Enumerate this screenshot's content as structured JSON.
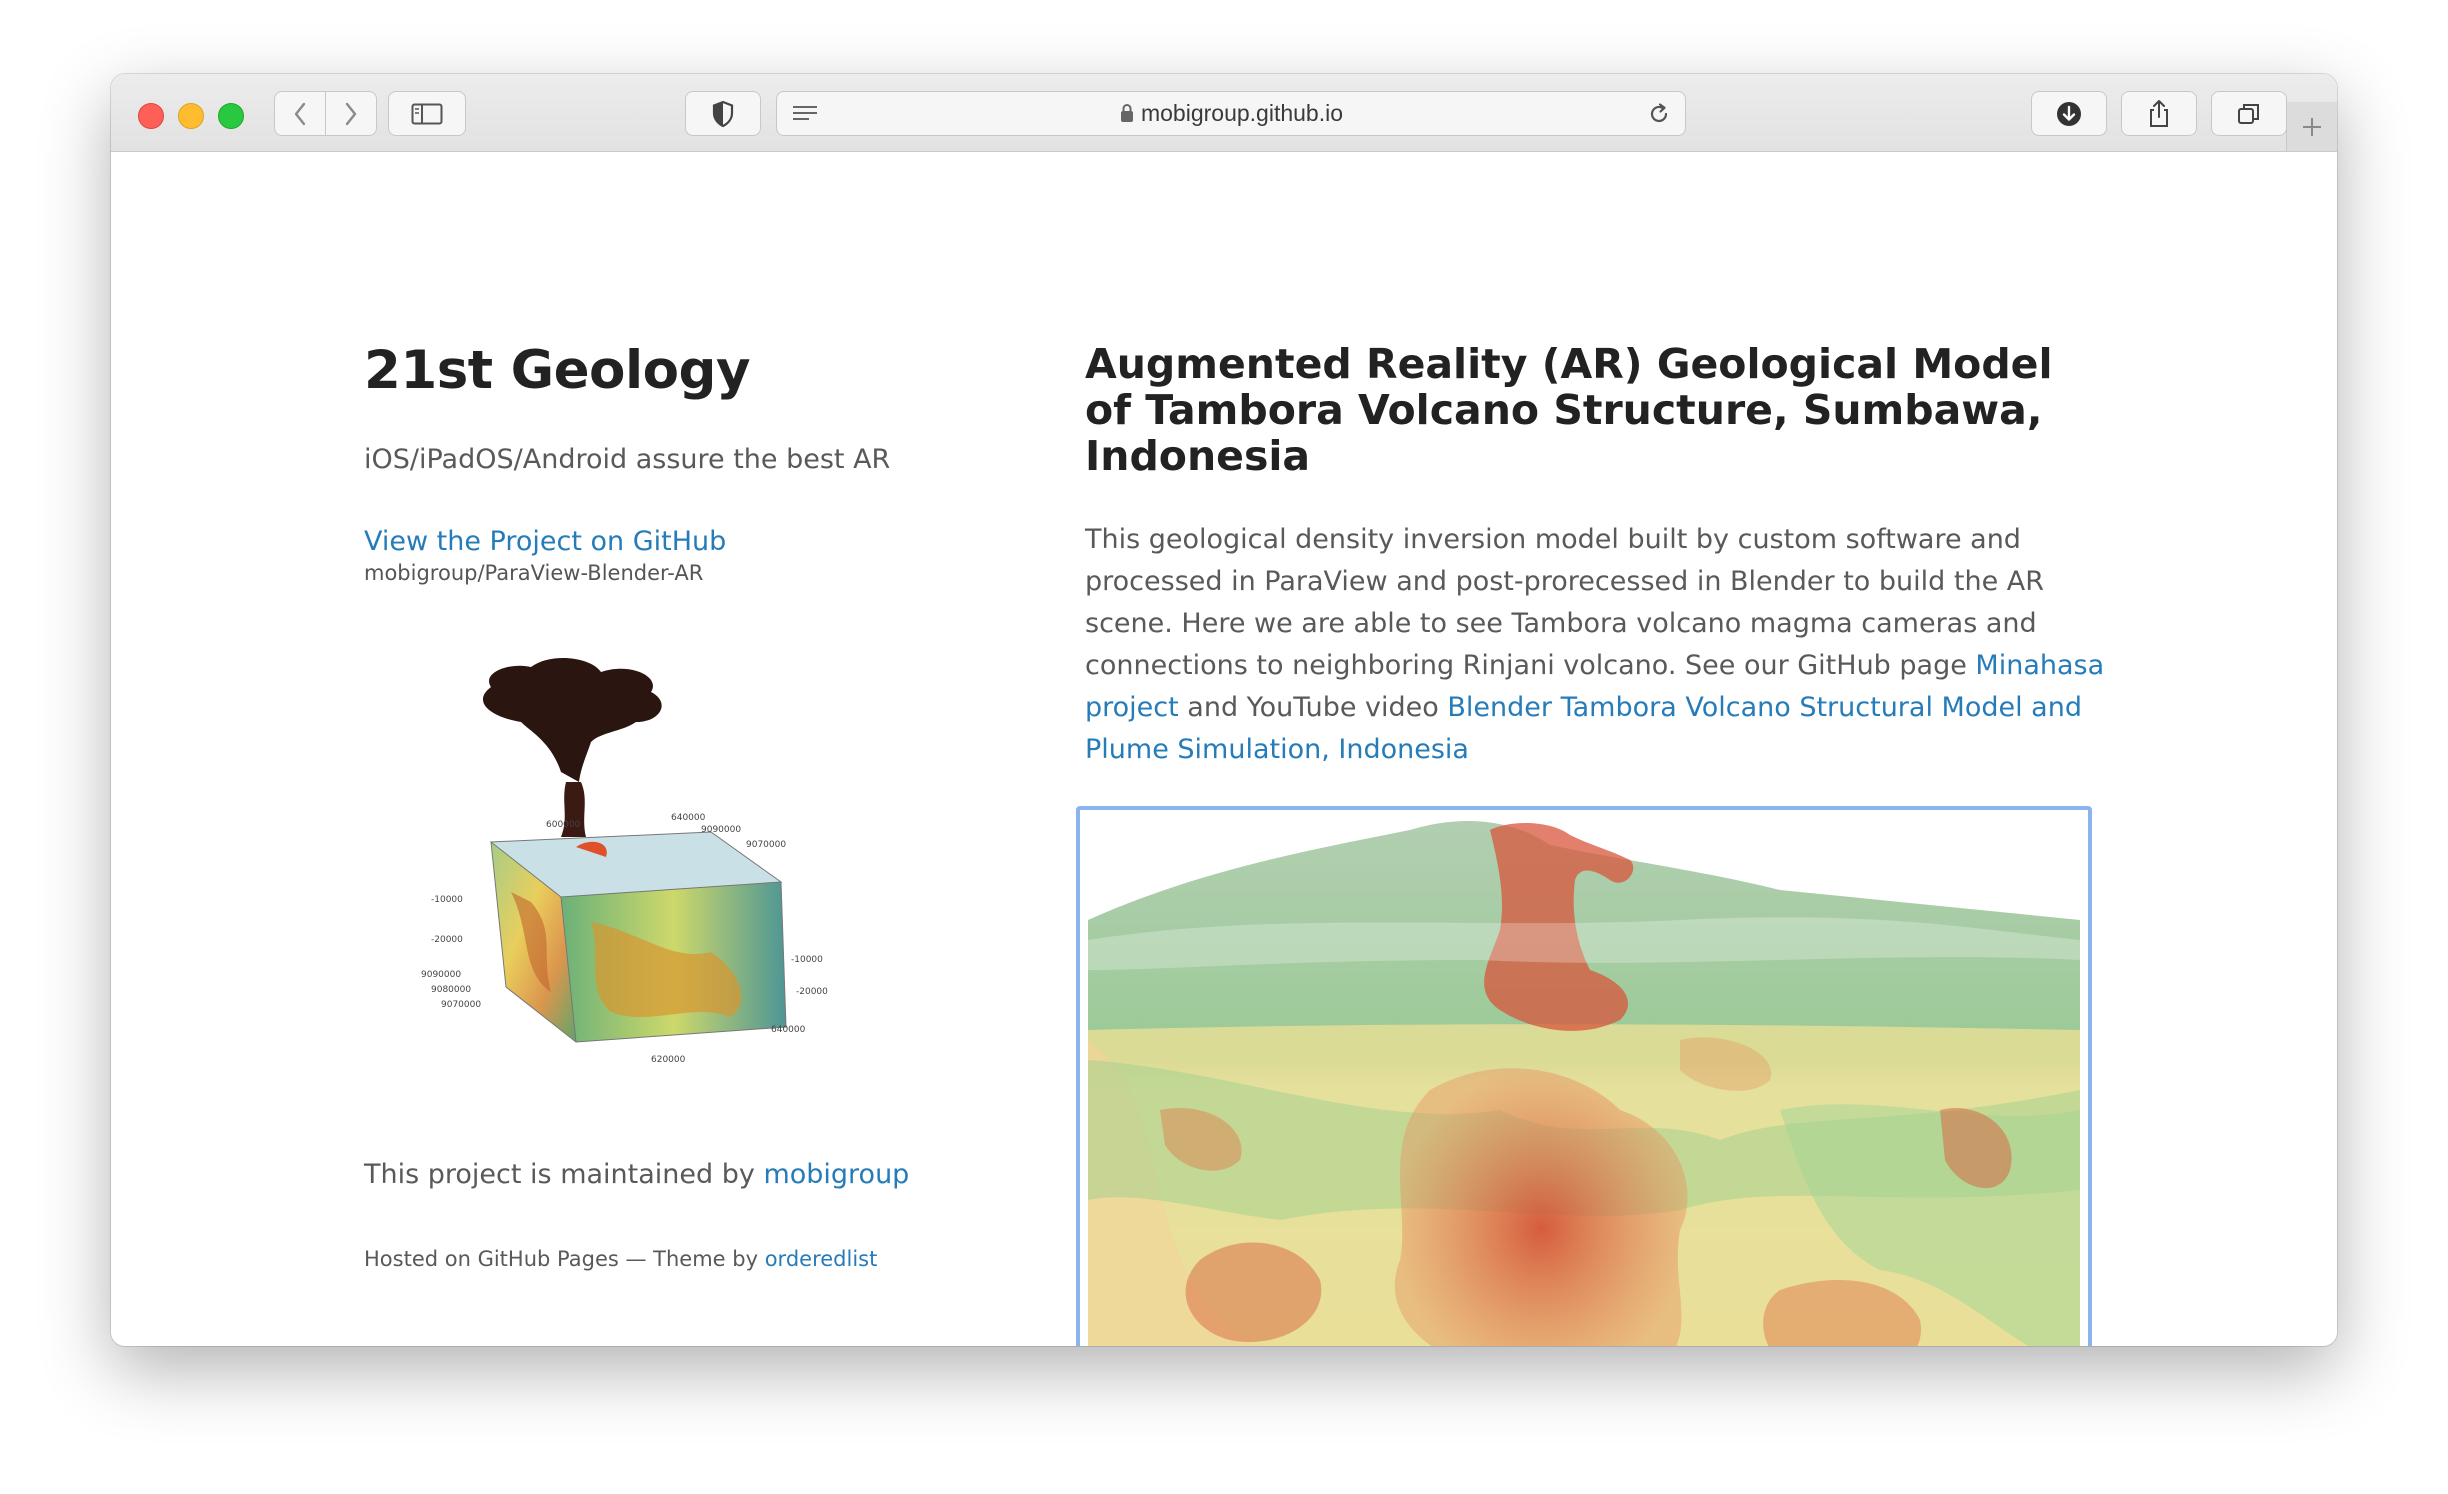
{
  "browser": {
    "url": "mobigroup.github.io",
    "icons": {
      "back": "chevron-left-icon",
      "forward": "chevron-right-icon",
      "sidebar": "sidebar-icon",
      "privacy": "shield-icon",
      "reader": "reader-icon",
      "lock": "lock-icon",
      "reload": "reload-icon",
      "downloads": "download-icon",
      "share": "share-icon",
      "tabs": "tabs-overview-icon",
      "new_tab": "plus-icon"
    }
  },
  "sidebar": {
    "title": "21st Geology",
    "tagline": "iOS/iPadOS/Android assure the best AR",
    "github_link": "View the Project on GitHub",
    "github_repo": "mobigroup/ParaView-Blender-AR",
    "maintained_prefix": "This project is maintained by ",
    "maintainer": "mobigroup",
    "hosted_text": "Hosted on GitHub Pages — Theme by ",
    "theme_author": "orderedlist"
  },
  "article": {
    "title": "Augmented Reality (AR) Geological Model of Tambora Volcano Structure, Sumbawa, Indonesia",
    "body_text": "This geological density inversion model built by custom software and processed in ParaView and post-prorecessed in Blender to build the AR scene. Here we are able to see Tambora volcano magma cameras and connections to neighboring Rinjani volcano. See our GitHub page ",
    "link1": "Minahasa project",
    "body_mid": " and YouTube video ",
    "link2": "Blender Tambora Volcano Structural Model and Plume Simulation, Indonesia"
  },
  "colors": {
    "link": "#267CB9",
    "heading": "#222222",
    "text": "#595959",
    "frame_border": "#8ab4ef"
  }
}
